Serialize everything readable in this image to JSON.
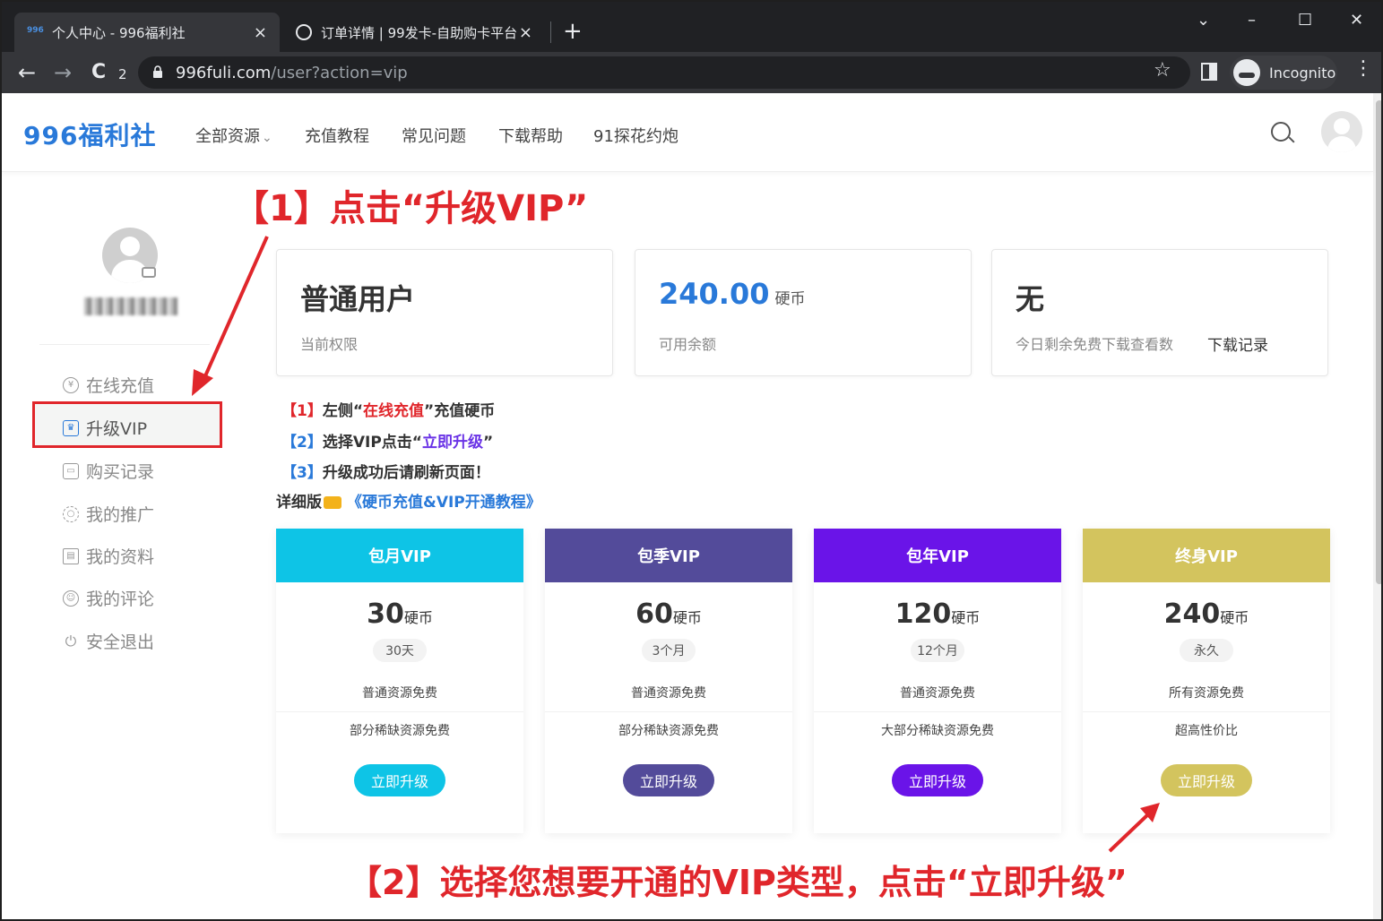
{
  "browser": {
    "tabs": [
      {
        "favicon": "996",
        "title": "个人中心 - 996福利社",
        "close": "×"
      },
      {
        "title": "订单详情 | 99发卡-自助购卡平台",
        "close": "×"
      }
    ],
    "new_tab": "+",
    "window_controls": {
      "minimize": "–",
      "maximize": "☐",
      "close": "✕",
      "dropdown": "⌄"
    },
    "nav": {
      "back": "←",
      "forward": "→",
      "reload": "C",
      "reload_count": "2"
    },
    "url": {
      "host": "996fuli.com",
      "path": "/user?action=vip"
    },
    "star": "☆",
    "profile": "Incognito",
    "menu": "⋮"
  },
  "site": {
    "logo": "996福利社",
    "nav": [
      {
        "label": "全部资源",
        "caret": "⌄"
      },
      {
        "label": "充值教程"
      },
      {
        "label": "常见问题"
      },
      {
        "label": "下载帮助"
      },
      {
        "label": "91探花约炮"
      }
    ]
  },
  "sidebar": {
    "items": [
      {
        "icon": "yen-icon",
        "glyph": "¥",
        "label": "在线充值"
      },
      {
        "icon": "crown-icon",
        "glyph": "♛",
        "label": "升级VIP"
      },
      {
        "icon": "bag-icon",
        "glyph": "▭",
        "label": "购买记录"
      },
      {
        "icon": "share-icon",
        "glyph": "○",
        "label": "我的推广"
      },
      {
        "icon": "profile-card-icon",
        "glyph": "▤",
        "label": "我的资料"
      },
      {
        "icon": "comment-icon",
        "glyph": "☺",
        "label": "我的评论"
      },
      {
        "icon": "power-icon",
        "glyph": "⏻",
        "label": "安全退出"
      }
    ]
  },
  "stats": [
    {
      "value": "普通用户",
      "unit": "",
      "label": "当前权限"
    },
    {
      "value": "240.00",
      "unit": "硬币",
      "label": "可用余额"
    },
    {
      "value": "无",
      "unit": "",
      "label": "今日剩余免费下载查看数",
      "link": "下载记录"
    }
  ],
  "instructions": {
    "step1": {
      "num": "【1】",
      "pre": "左侧“",
      "highlight": "在线充值",
      "post": "”充值硬币"
    },
    "step2": {
      "num": "【2】",
      "pre": "选择VIP点击“",
      "highlight": "立即升级",
      "post": "”"
    },
    "step3": {
      "num": "【3】",
      "text": "升级成功后请刷新页面！"
    },
    "detail": {
      "label": "详细版",
      "link": "《硬币充值&VIP开通教程》"
    }
  },
  "plans": [
    {
      "name": "包月VIP",
      "price": "30",
      "unit": "硬币",
      "duration": "30天",
      "feature1": "普通资源免费",
      "feature2": "部分稀缺资源免费",
      "button": "立即升级",
      "color": "#0ec4e6"
    },
    {
      "name": "包季VIP",
      "price": "60",
      "unit": "硬币",
      "duration": "3个月",
      "feature1": "普通资源免费",
      "feature2": "部分稀缺资源免费",
      "button": "立即升级",
      "color": "#534b9a"
    },
    {
      "name": "包年VIP",
      "price": "120",
      "unit": "硬币",
      "duration": "12个月",
      "feature1": "普通资源免费",
      "feature2": "大部分稀缺资源免费",
      "button": "立即升级",
      "color": "#6a14e8"
    },
    {
      "name": "终身VIP",
      "price": "240",
      "unit": "硬币",
      "duration": "永久",
      "feature1": "所有资源免费",
      "feature2": "超高性价比",
      "button": "立即升级",
      "color": "#d3c45e"
    }
  ],
  "annotations": {
    "top": "【1】点击“升级VIP”",
    "bottom": "【2】选择您想要开通的VIP类型，点击“立即升级”",
    "color": "#e0262b"
  }
}
